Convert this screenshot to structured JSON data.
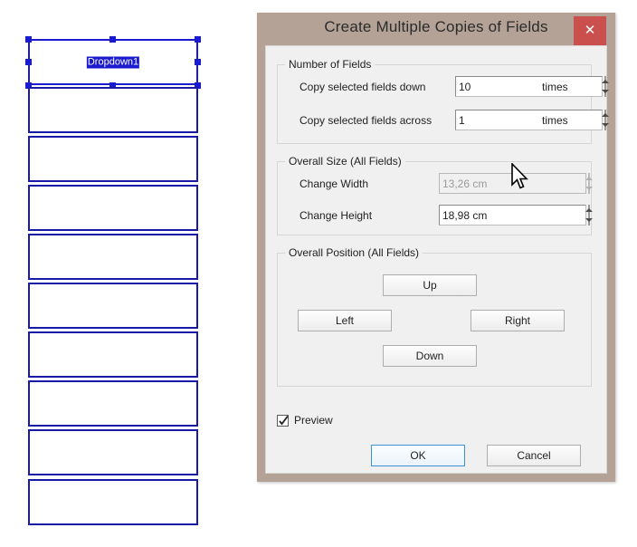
{
  "canvas": {
    "selected_field_label": "Dropdown1",
    "field_count": 10,
    "field_outline_color": "#1a1aa8",
    "selection_color": "#1a1ad0"
  },
  "dialog": {
    "title": "Create Multiple Copies of Fields",
    "close_icon": "close-icon",
    "close_button_color": "#c9504d",
    "frame_color": "#b3a295",
    "body_color": "#f0f0f0",
    "groups": {
      "number_of_fields": {
        "title": "Number of Fields",
        "rows": [
          {
            "label": "Copy selected fields down",
            "value": "10",
            "suffix": "times",
            "disabled": false
          },
          {
            "label": "Copy selected fields across",
            "value": "1",
            "suffix": "times",
            "disabled": false
          }
        ]
      },
      "overall_size": {
        "title": "Overall Size (All Fields)",
        "rows": [
          {
            "label": "Change Width",
            "value": "13,26 cm",
            "suffix": "",
            "disabled": true
          },
          {
            "label": "Change Height",
            "value": "18,98 cm",
            "suffix": "",
            "disabled": false
          }
        ]
      },
      "overall_position": {
        "title": "Overall Position (All Fields)",
        "buttons": {
          "up": "Up",
          "left": "Left",
          "right": "Right",
          "down": "Down"
        }
      }
    },
    "preview": {
      "label": "Preview",
      "checked": true
    },
    "footer": {
      "ok": "OK",
      "cancel": "Cancel",
      "default_button": "ok",
      "focus_color": "#3c93d4"
    }
  }
}
